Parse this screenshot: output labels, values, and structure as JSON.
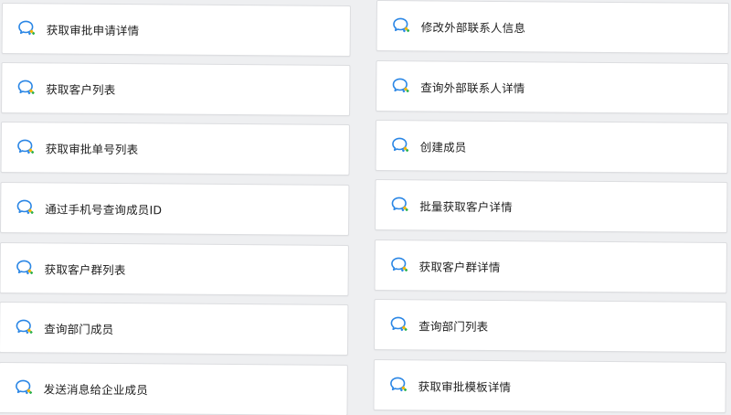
{
  "colors": {
    "background": "#eeeff1",
    "card": "#ffffff",
    "card_border": "#dcdde0",
    "icon_blue": "#2a86e5",
    "icon_yellow": "#f5b400",
    "icon_green": "#2cb14a",
    "text": "#1f1f1f"
  },
  "card_icon": "wecom-chat-bubble-icon",
  "left_column": [
    {
      "label": "获取审批申请详情"
    },
    {
      "label": "获取客户列表"
    },
    {
      "label": "获取审批单号列表"
    },
    {
      "label": "通过手机号查询成员ID"
    },
    {
      "label": "获取客户群列表"
    },
    {
      "label": "查询部门成员"
    },
    {
      "label": "发送消息给企业成员"
    }
  ],
  "right_column": [
    {
      "label": "修改外部联系人信息"
    },
    {
      "label": "查询外部联系人详情"
    },
    {
      "label": "创建成员"
    },
    {
      "label": "批量获取客户详情"
    },
    {
      "label": "获取客户群详情"
    },
    {
      "label": "查询部门列表"
    },
    {
      "label": "获取审批模板详情"
    }
  ]
}
